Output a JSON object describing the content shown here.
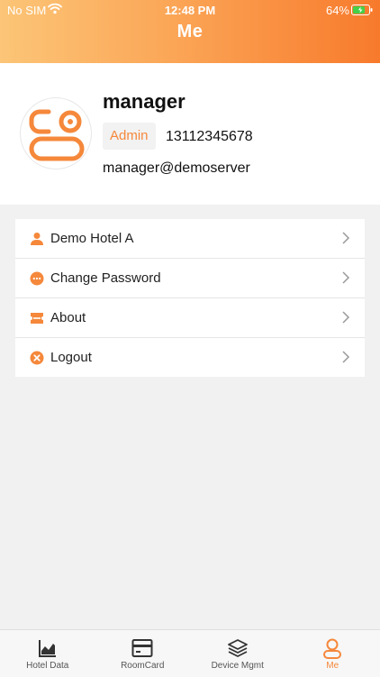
{
  "status_bar": {
    "carrier": "No SIM",
    "time": "12:48 PM",
    "battery": "64%"
  },
  "header": {
    "title": "Me"
  },
  "profile": {
    "name": "manager",
    "role": "Admin",
    "phone": "13112345678",
    "email": "manager@demoserver"
  },
  "menu": {
    "items": [
      {
        "label": "Demo Hotel A",
        "icon": "person-icon"
      },
      {
        "label": "Change Password",
        "icon": "dots-icon"
      },
      {
        "label": "About",
        "icon": "ticket-icon"
      },
      {
        "label": "Logout",
        "icon": "close-circle-icon"
      }
    ]
  },
  "tabbar": {
    "tabs": [
      {
        "label": "Hotel Data",
        "icon": "area-chart-icon"
      },
      {
        "label": "RoomCard",
        "icon": "card-icon"
      },
      {
        "label": "Device Mgmt",
        "icon": "layers-icon"
      },
      {
        "label": "Me",
        "icon": "user-icon"
      }
    ],
    "active": "Me"
  },
  "colors": {
    "accent": "#f5883b",
    "header_start": "#fcc577",
    "header_end": "#f87a2c"
  }
}
